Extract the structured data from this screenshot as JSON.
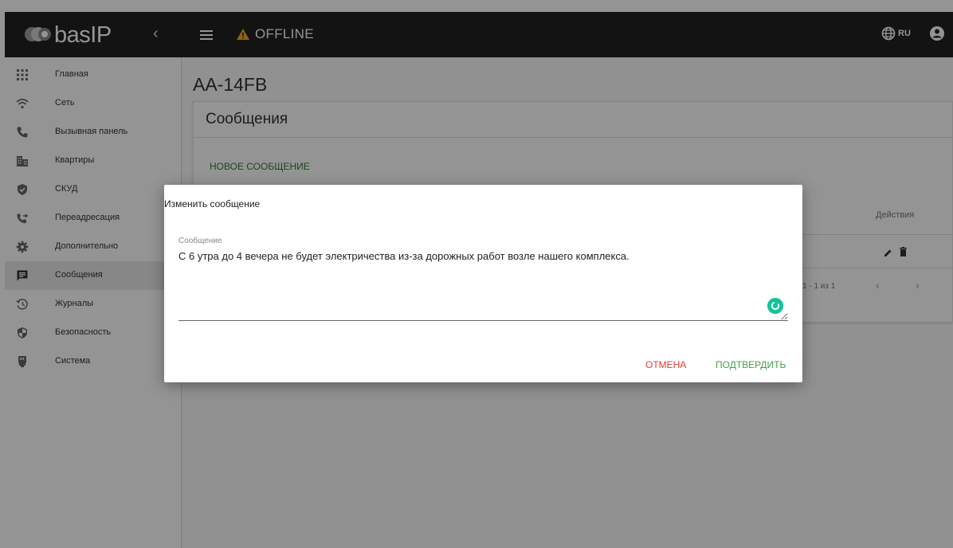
{
  "header": {
    "logo_text": "basIP",
    "collapse_icon": "chevron-left-icon",
    "menu_icon": "hamburger-icon",
    "status_icon": "warning-icon",
    "status_text": "OFFLINE",
    "language_code": "RU",
    "language_icon": "globe-icon",
    "user_icon": "account-icon",
    "bg_color": "#212121",
    "warning_color": "#f9a825"
  },
  "sidebar": {
    "items": [
      {
        "label": "Главная",
        "icon": "grid-icon",
        "active": false
      },
      {
        "label": "Сеть",
        "icon": "wifi-icon",
        "active": false
      },
      {
        "label": "Вызывная панель",
        "icon": "phone-icon",
        "active": false
      },
      {
        "label": "Квартиры",
        "icon": "building-icon",
        "active": false
      },
      {
        "label": "СКУД",
        "icon": "shield-check-icon",
        "active": false
      },
      {
        "label": "Переадресация",
        "icon": "phone-forward-icon",
        "active": false
      },
      {
        "label": "Дополнительно",
        "icon": "gear-icon",
        "active": false
      },
      {
        "label": "Сообщения",
        "icon": "message-icon",
        "active": true
      },
      {
        "label": "Журналы",
        "icon": "history-icon",
        "active": false
      },
      {
        "label": "Безопасность",
        "icon": "security-icon",
        "active": false
      },
      {
        "label": "Система",
        "icon": "ethernet-port-icon",
        "active": false
      }
    ]
  },
  "main": {
    "device_title": "AA-14FB",
    "card_title": "Сообщения",
    "new_message_button": "НОВОЕ СООБЩЕНИЕ",
    "table": {
      "actions_header": "Действия",
      "row_actions": [
        "edit-icon",
        "delete-icon"
      ]
    },
    "pagination": {
      "range_text": "1 - 1 из 1",
      "prev_icon": "chevron-left-icon",
      "next_icon": "chevron-right-icon"
    }
  },
  "dialog": {
    "title": "Изменить сообщение",
    "field_label": "Сообщение",
    "field_value": "С 6 утра до 4 вечера не будет электричества из-за дорожных работ возле нашего комплекса.",
    "cancel_label": "ОТМЕНА",
    "confirm_label": "ПОДТВЕРДИТЬ",
    "cancel_color": "#e53935",
    "confirm_color": "#43a047",
    "assistant_icon": "grammarly-icon"
  }
}
